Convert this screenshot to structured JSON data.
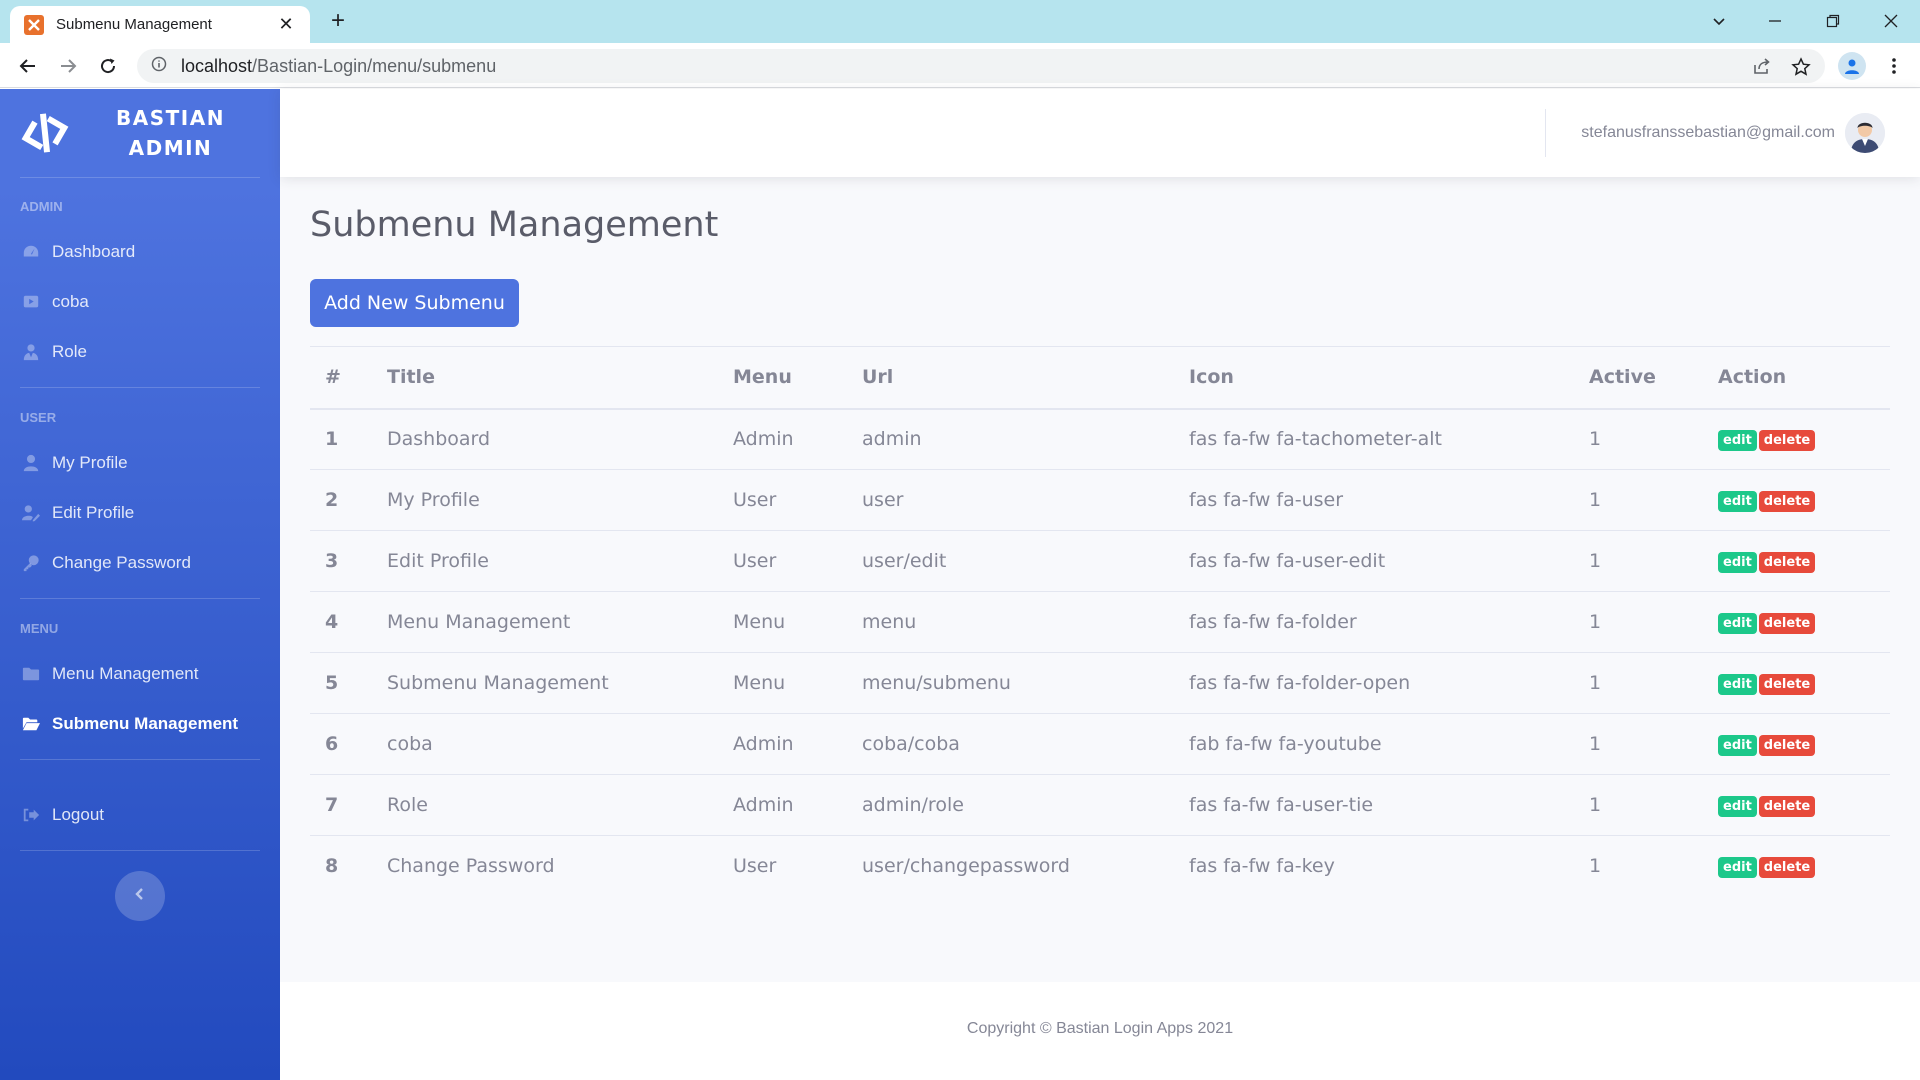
{
  "browser": {
    "tab_title": "Submenu Management",
    "url_host": "localhost",
    "url_path": "/Bastian-Login/menu/submenu"
  },
  "brand": {
    "line1": "BASTIAN",
    "line2": "ADMIN"
  },
  "sidebar": {
    "sections": [
      {
        "heading": "ADMIN",
        "items": [
          {
            "label": "Dashboard",
            "icon": "tachometer-icon"
          },
          {
            "label": "coba",
            "icon": "youtube-icon"
          },
          {
            "label": "Role",
            "icon": "user-tie-icon"
          }
        ]
      },
      {
        "heading": "USER",
        "items": [
          {
            "label": "My Profile",
            "icon": "user-icon"
          },
          {
            "label": "Edit Profile",
            "icon": "user-edit-icon"
          },
          {
            "label": "Change Password",
            "icon": "key-icon"
          }
        ]
      },
      {
        "heading": "MENU",
        "items": [
          {
            "label": "Menu Management",
            "icon": "folder-icon"
          },
          {
            "label": "Submenu Management",
            "icon": "folder-open-icon",
            "active": true
          }
        ]
      }
    ],
    "logout": "Logout"
  },
  "topbar": {
    "user_email": "stefanusfranssebastian@gmail.com"
  },
  "page": {
    "title": "Submenu Management",
    "add_button": "Add New Submenu"
  },
  "table": {
    "headers": [
      "#",
      "Title",
      "Menu",
      "Url",
      "Icon",
      "Active",
      "Action"
    ],
    "rows": [
      {
        "no": "1",
        "title": "Dashboard",
        "menu": "Admin",
        "url": "admin",
        "icon": "fas fa-fw fa-tachometer-alt",
        "active": "1"
      },
      {
        "no": "2",
        "title": "My Profile",
        "menu": "User",
        "url": "user",
        "icon": "fas fa-fw fa-user",
        "active": "1"
      },
      {
        "no": "3",
        "title": "Edit Profile",
        "menu": "User",
        "url": "user/edit",
        "icon": "fas fa-fw fa-user-edit",
        "active": "1"
      },
      {
        "no": "4",
        "title": "Menu Management",
        "menu": "Menu",
        "url": "menu",
        "icon": "fas fa-fw fa-folder",
        "active": "1"
      },
      {
        "no": "5",
        "title": "Submenu Management",
        "menu": "Menu",
        "url": "menu/submenu",
        "icon": "fas fa-fw fa-folder-open",
        "active": "1"
      },
      {
        "no": "6",
        "title": "coba",
        "menu": "Admin",
        "url": "coba/coba",
        "icon": "fab fa-fw fa-youtube",
        "active": "1"
      },
      {
        "no": "7",
        "title": "Role",
        "menu": "Admin",
        "url": "admin/role",
        "icon": "fas fa-fw fa-user-tie",
        "active": "1"
      },
      {
        "no": "8",
        "title": "Change Password",
        "menu": "User",
        "url": "user/changepassword",
        "icon": "fas fa-fw fa-key",
        "active": "1"
      }
    ],
    "edit_label": "edit",
    "delete_label": "delete"
  },
  "footer": {
    "text": "Copyright © Bastian Login Apps 2021"
  },
  "colors": {
    "primary": "#4e73df",
    "success": "#1cc88a",
    "danger": "#e74a3b",
    "text": "#858796"
  }
}
